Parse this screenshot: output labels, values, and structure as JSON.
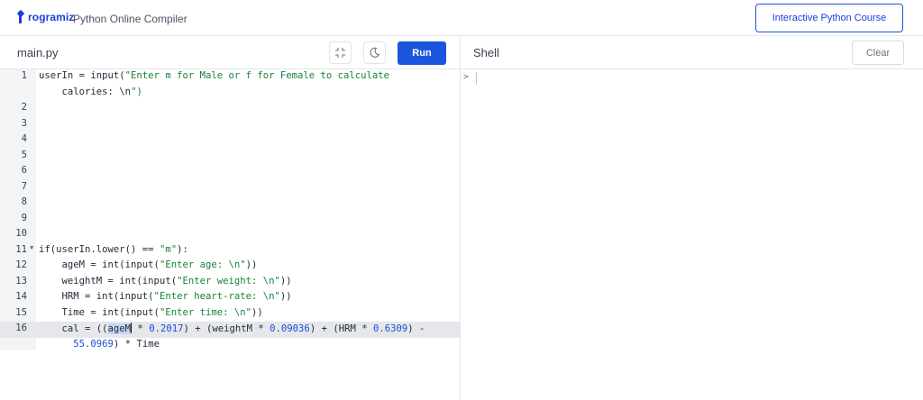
{
  "header": {
    "logo_text": "rogramiz",
    "app_title": "Python Online Compiler",
    "course_button": "Interactive Python Course"
  },
  "editor": {
    "file_tab": "main.py",
    "run_label": "Run",
    "collapse_icon": "collapse-icon",
    "theme_icon": "moon-icon",
    "lines": [
      {
        "n": "1",
        "text": "userIn = input(\"Enter m for Male or f for Female to calculate"
      },
      {
        "n": "",
        "text": "    calories: \\n\")"
      },
      {
        "n": "2",
        "text": ""
      },
      {
        "n": "3",
        "text": ""
      },
      {
        "n": "4",
        "text": ""
      },
      {
        "n": "5",
        "text": ""
      },
      {
        "n": "6",
        "text": ""
      },
      {
        "n": "7",
        "text": ""
      },
      {
        "n": "8",
        "text": ""
      },
      {
        "n": "9",
        "text": ""
      },
      {
        "n": "10",
        "text": ""
      },
      {
        "n": "11",
        "text": "if(userIn.lower() == \"m\"):"
      },
      {
        "n": "12",
        "text": "    ageM = int(input(\"Enter age: \\n\"))"
      },
      {
        "n": "13",
        "text": "    weightM = int(input(\"Enter weight: \\n\"))"
      },
      {
        "n": "14",
        "text": "    HRM = int(input(\"Enter heart-rate: \\n\"))"
      },
      {
        "n": "15",
        "text": "    Time = int(input(\"Enter time: \\n\"))"
      },
      {
        "n": "16",
        "text": "    cal = ((ageM * 0.2017) + (weightM * 0.09036) + (HRM * 0.6309) -"
      },
      {
        "n": "",
        "text": "      55.0969) * Time"
      }
    ],
    "active_line": "16"
  },
  "shell": {
    "title": "Shell",
    "clear_label": "Clear",
    "prompt": ">"
  },
  "colors": {
    "accent": "#1a56db",
    "string": "#16833b",
    "number": "#1d4ed8"
  }
}
